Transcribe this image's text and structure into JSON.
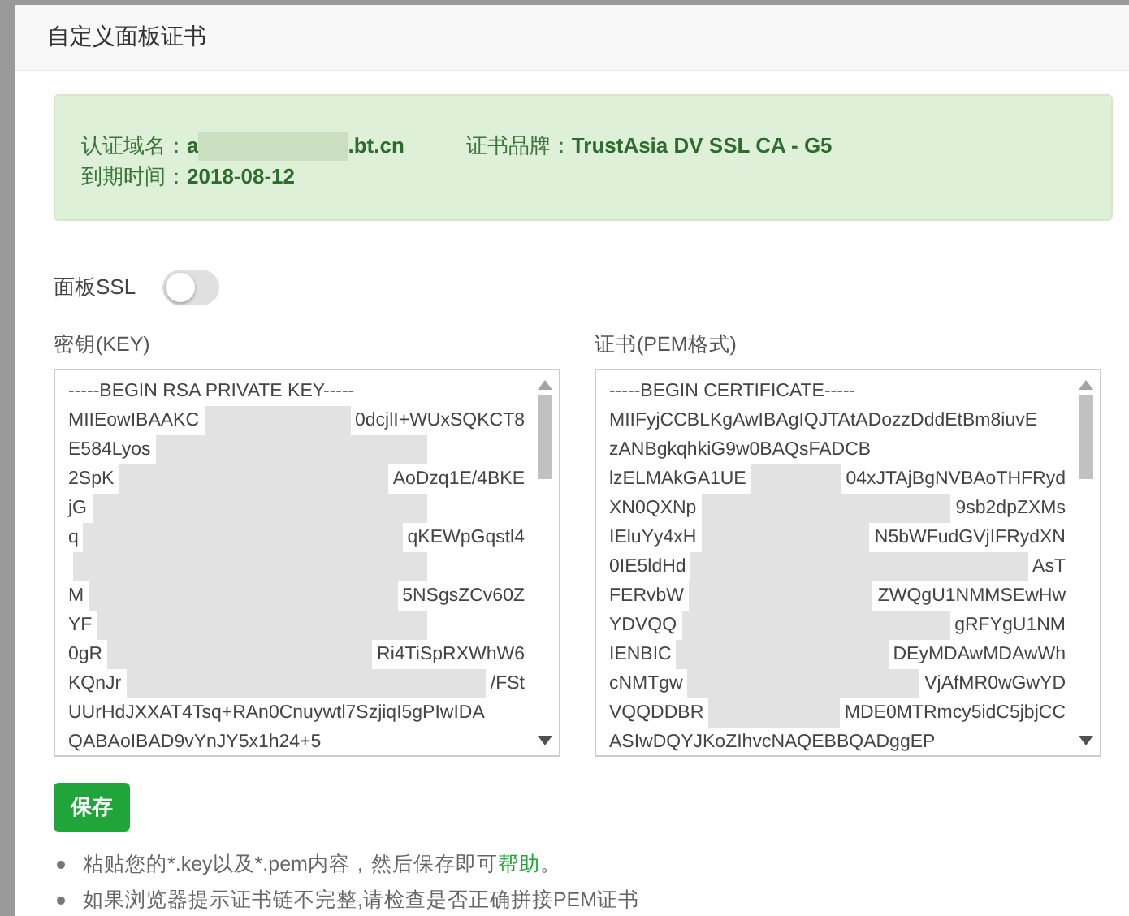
{
  "dialog": {
    "title": "自定义面板证书"
  },
  "cert_info": {
    "domain_label": "认证域名：",
    "domain_parts": [
      "a",
      ".bt.cn"
    ],
    "brand_label": "证书品牌：",
    "brand": "TrustAsia DV SSL CA - G5",
    "expiry_label": "到期时间：",
    "expiry": "2018-08-12"
  },
  "panel_ssl": {
    "label": "面板SSL",
    "on": false
  },
  "key_box": {
    "label": "密钥(KEY)",
    "lines": [
      {
        "parts": [
          "-----BEGIN RSA PRIVATE KEY-----"
        ],
        "redacted": false
      },
      {
        "parts": [
          "MIIEowIBAAKC",
          "0dcjlI+WUxSQKCT8"
        ],
        "redacted": true
      },
      {
        "parts": [
          "E584Lyos"
        ],
        "redacted": true
      },
      {
        "parts": [
          "2SpK",
          "AoDzq1E/4BKE"
        ],
        "redacted": true
      },
      {
        "parts": [
          "jG"
        ],
        "redacted": true
      },
      {
        "parts": [
          "q",
          "qKEWpGqstl4"
        ],
        "redacted": true
      },
      {
        "redacted": true
      },
      {
        "parts": [
          "M",
          "5NSgsZCv60Z"
        ],
        "redacted": true
      },
      {
        "parts": [
          "YF"
        ],
        "redacted": true
      },
      {
        "parts": [
          "0gR",
          "Ri4TiSpRXWhW6"
        ],
        "redacted": true
      },
      {
        "parts": [
          "KQnJr",
          "/FSt"
        ],
        "redacted": true
      },
      {
        "parts": [
          "UUrHdJXXAT4Tsq+RAn0Cnuywtl7SzjiqI5gPIwIDA"
        ],
        "redacted": false
      },
      {
        "parts": [
          "QABAoIBAD9vYnJY5x1h24+5"
        ],
        "redacted": false
      }
    ]
  },
  "cert_box": {
    "label": "证书(PEM格式)",
    "lines": [
      {
        "parts": [
          "-----BEGIN CERTIFICATE-----"
        ],
        "redacted": false
      },
      {
        "parts": [
          "MIIFyjCCBLKgAwIBAgIQJTAtADozzDddEtBm8iuvE"
        ],
        "redacted": false
      },
      {
        "parts": [
          "zANBgkqhkiG9w0BAQsFADCB"
        ],
        "redacted": false
      },
      {
        "parts": [
          "lzELMAkGA1UE",
          "04xJTAjBgNVBAoTHFRyd"
        ],
        "redacted": true
      },
      {
        "parts": [
          "XN0QXNp",
          "9sb2dpZXMs"
        ],
        "redacted": true
      },
      {
        "parts": [
          "IEluYy4xH",
          "N5bWFudGVjIFRydXN"
        ],
        "redacted": true
      },
      {
        "parts": [
          "0IE5ldHd",
          "AsT"
        ],
        "redacted": true
      },
      {
        "parts": [
          "FERvbW",
          "ZWQgU1NMMSEwHw"
        ],
        "redacted": true
      },
      {
        "parts": [
          "YDVQQ",
          "gRFYgU1NM"
        ],
        "redacted": true
      },
      {
        "parts": [
          "IENBIC",
          "DEyMDAwMDAwWh"
        ],
        "redacted": true
      },
      {
        "parts": [
          "cNMTgw",
          "VjAfMR0wGwYD"
        ],
        "redacted": true
      },
      {
        "parts": [
          "VQQDDBR",
          "MDE0MTRmcy5idC5jbjCC"
        ],
        "redacted": true
      },
      {
        "parts": [
          "ASIwDQYJKoZIhvcNAQEBBQADggEP"
        ],
        "redacted": false
      }
    ]
  },
  "save_button": "保存",
  "tips": [
    {
      "text": "粘贴您的*.key以及*.pem内容，然后保存即可",
      "link": "帮助",
      "tail": "。"
    },
    {
      "text": "如果浏览器提示证书链不完整,请检查是否正确拼接PEM证书"
    }
  ]
}
